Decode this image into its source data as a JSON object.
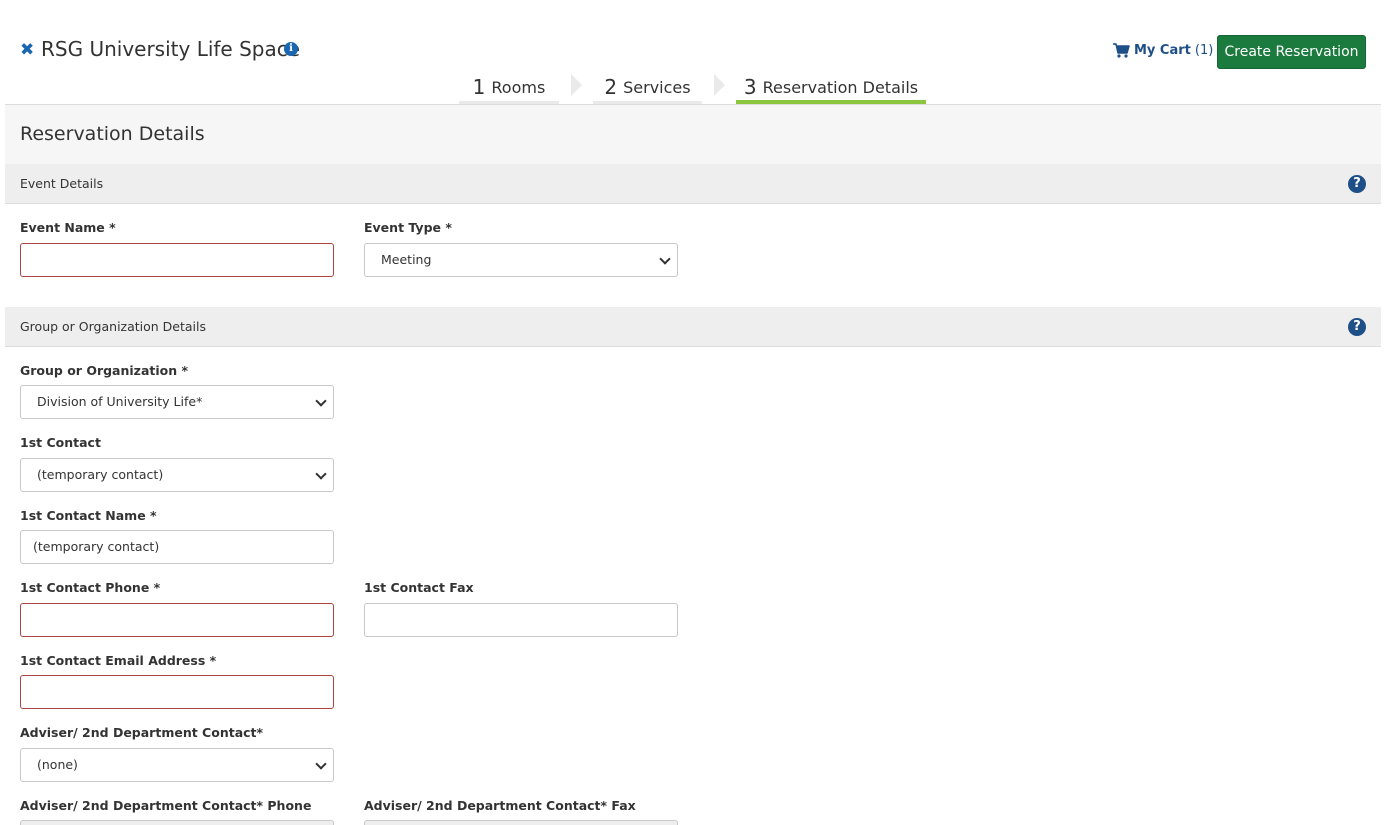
{
  "header": {
    "title": "RSG University Life Space",
    "cart_label": "My Cart",
    "cart_count": "(1)",
    "create_button": "Create Reservation"
  },
  "steps": [
    {
      "num": "1",
      "label": "Rooms",
      "active": false
    },
    {
      "num": "2",
      "label": "Services",
      "active": false
    },
    {
      "num": "3",
      "label": "Reservation Details",
      "active": true
    }
  ],
  "page_title": "Reservation Details",
  "sections": {
    "event": "Event Details",
    "group": "Group or Organization Details"
  },
  "fields": {
    "event_name": {
      "label": "Event Name *",
      "value": ""
    },
    "event_type": {
      "label": "Event Type *",
      "value": "Meeting"
    },
    "group_org": {
      "label": "Group or Organization *",
      "value": "Division of University Life*"
    },
    "contact1": {
      "label": "1st Contact",
      "value": "(temporary contact)"
    },
    "contact1_name": {
      "label": "1st Contact Name *",
      "value": "(temporary contact)"
    },
    "contact1_phone": {
      "label": "1st Contact Phone *",
      "value": ""
    },
    "contact1_fax": {
      "label": "1st Contact Fax",
      "value": ""
    },
    "contact1_email": {
      "label": "1st Contact Email Address *",
      "value": ""
    },
    "adviser": {
      "label": "Adviser/ 2nd Department Contact*",
      "value": "(none)"
    },
    "adviser_phone": {
      "label": "Adviser/ 2nd Department Contact* Phone",
      "value": ""
    },
    "adviser_fax": {
      "label": "Adviser/ 2nd Department Contact* Fax",
      "value": ""
    }
  },
  "colors": {
    "primary_button": "#1b7a3d",
    "active_step": "#8cc63f",
    "required_border": "#a94442",
    "link_blue": "#1f4f87"
  },
  "icons": [
    "close-icon",
    "info-icon",
    "cart-icon",
    "help-icon",
    "chevron-down-icon"
  ]
}
